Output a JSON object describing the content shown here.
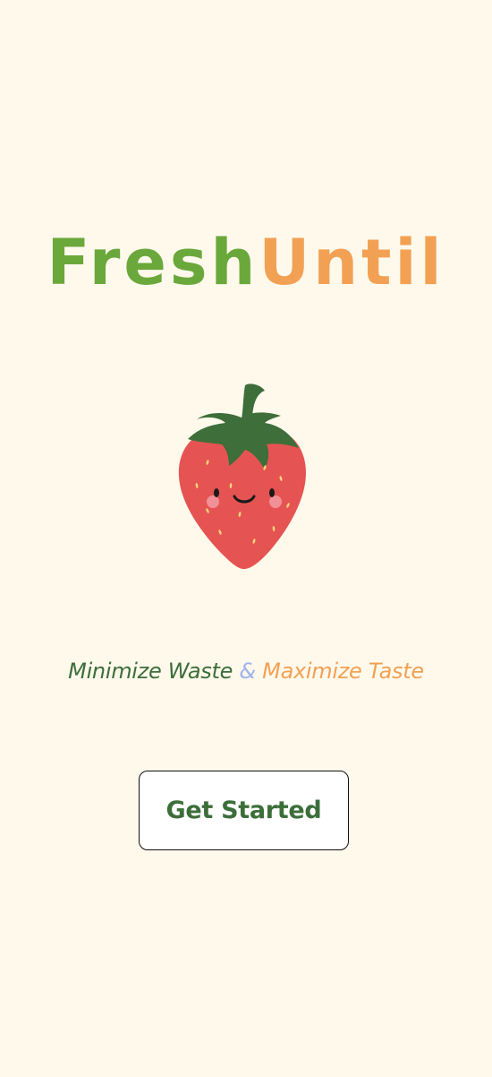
{
  "app": {
    "logo_part_1": "Fresh",
    "logo_part_2": "Until"
  },
  "hero": {
    "image": "strawberry-mascot-illustration"
  },
  "tagline": {
    "part_1": "Minimize Waste",
    "connector": "&",
    "part_2": "Maximize Taste"
  },
  "actions": {
    "get_started_label": "Get Started"
  },
  "colors": {
    "background": "#FFF9EC",
    "brand_green": "#6AA83B",
    "brand_orange": "#F2A154",
    "dark_green": "#3C6E3A",
    "ampersand_blue": "#9FB3F0",
    "strawberry_red": "#E55452",
    "leaf_green": "#3E6E3A"
  }
}
